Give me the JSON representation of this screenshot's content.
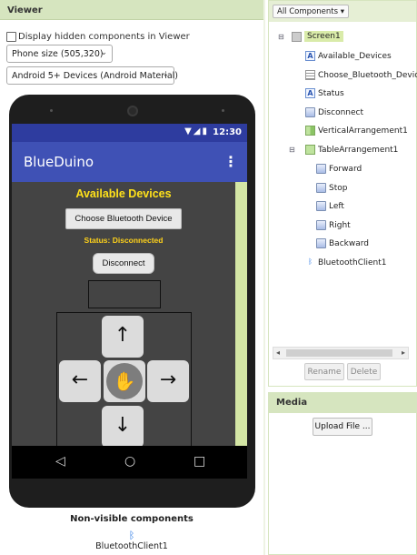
{
  "viewer": {
    "title": "Viewer",
    "hidden_checkbox_label": "Display hidden components in Viewer",
    "size_select": "Phone size (505,320)",
    "theme_select": "Android 5+ Devices (Android Material)"
  },
  "phone": {
    "time": "12:30",
    "status_icons": "▼◢▮",
    "app_title": "BlueDuino",
    "menu_icon": "⋮",
    "available_label": "Available Devices",
    "choose_button": "Choose Bluetooth Device",
    "status_label": "Status: Disconnected",
    "disconnect_button": "Disconnect",
    "forward_arrow": "↑",
    "left_arrow": "←",
    "stop_glyph": "✋",
    "right_arrow": "→",
    "backward_arrow": "↓",
    "nav_back": "◁",
    "nav_home": "○",
    "nav_recent": "□"
  },
  "nonvisible": {
    "title": "Non-visible components",
    "bt_icon": "ᛒ",
    "item": "BluetoothClient1"
  },
  "components": {
    "filter": "All Components",
    "filter_caret": "▾",
    "toggle_open": "⊟",
    "bt_icon": "ᛒ",
    "tree": {
      "screen": "Screen1",
      "available": "Available_Devices",
      "chooser": "Choose_Bluetooth_Device",
      "status": "Status",
      "disconnect": "Disconnect",
      "varr": "VerticalArrangement1",
      "table": "TableArrangement1",
      "forward": "Forward",
      "stop": "Stop",
      "left": "Left",
      "right": "Right",
      "backward": "Backward",
      "bt": "BluetoothClient1"
    },
    "scroll_left": "◂",
    "scroll_right": "▸",
    "rename": "Rename",
    "delete": "Delete"
  },
  "media": {
    "title": "Media",
    "upload": "Upload File ..."
  }
}
